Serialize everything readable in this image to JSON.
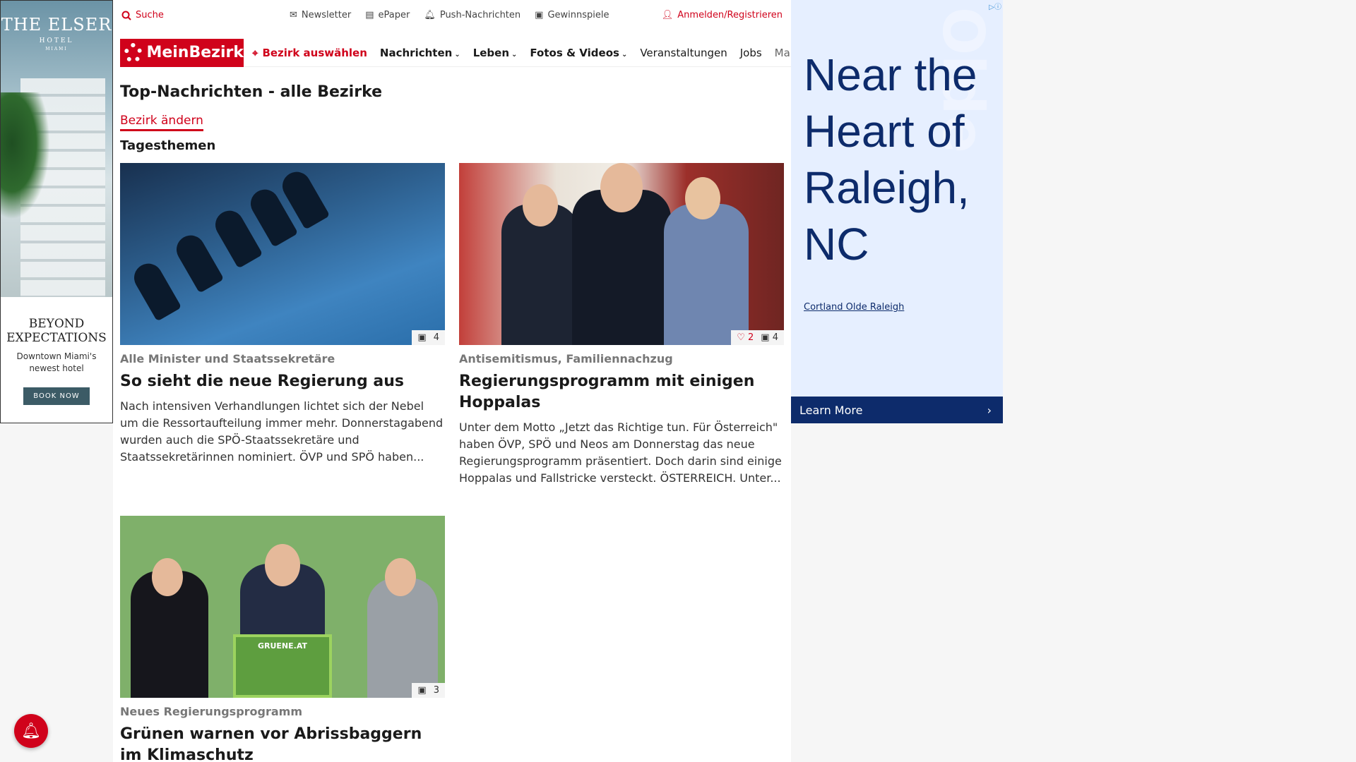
{
  "ad_left": {
    "brand": "THE ELSER",
    "brand_sub": "HOTEL",
    "brand_city": "MIAMI",
    "headline": "BEYOND EXPECTATIONS",
    "copy": "Downtown Miami's newest hotel",
    "button": "BOOK NOW"
  },
  "topbar": {
    "search": "Suche",
    "links": [
      "Newsletter",
      "ePaper",
      "Push-Nachrichten",
      "Gewinnspiele"
    ],
    "login": "Anmelden/Registrieren"
  },
  "nav": {
    "logo": "MeinBezirk",
    "location": "Bezirk auswählen",
    "items": [
      "Nachrichten",
      "Leben",
      "Fotos & Videos",
      "Veranstaltungen",
      "Jobs",
      "Marktplatz"
    ]
  },
  "page": {
    "title": "Top-Nachrichten - alle Bezirke",
    "change": "Bezirk ändern",
    "section": "Tagesthemen"
  },
  "articles": [
    {
      "kicker": "Alle Minister und Staatssekretäre",
      "title": "So sieht die neue Regierung aus",
      "teaser": "Nach intensiven Verhandlungen lichtet sich der Nebel um die Ressortaufteilung immer mehr. Donnerstagabend wurden auch die SPÖ-Staatssekretäre und Staatssekretärinnen nominiert. ÖVP und SPÖ haben...",
      "photos": "4",
      "likes": ""
    },
    {
      "kicker": "Antisemitismus, Familiennachzug",
      "title": "Regierungsprogramm mit einigen Hoppalas",
      "teaser": "Unter dem Motto „Jetzt das Richtige tun. Für Österreich\" haben ÖVP, SPÖ und Neos am Donnerstag das neue Regierungsprogramm präsentiert. Doch darin sind einige Hoppalas und Fallstricke versteckt. ÖSTERREICH. Unter...",
      "photos": "4",
      "likes": "2"
    },
    {
      "kicker": "Neues Regierungsprogramm",
      "title": "Grünen warnen vor Abrissbaggern im Klimaschutz",
      "teaser": "",
      "photos": "3",
      "likes": "",
      "podium": "GRUENE.AT"
    }
  ],
  "ad_right": {
    "headline": "Near the Heart of Raleigh, NC",
    "advertiser": "Cortland Olde Raleigh",
    "cta": "Learn More"
  }
}
